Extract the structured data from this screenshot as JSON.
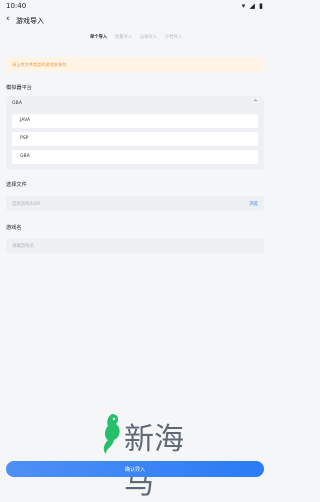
{
  "status": {
    "time": "10:40"
  },
  "appbar": {
    "title": "游戏导入"
  },
  "tabs": [
    {
      "label": "单个导入"
    },
    {
      "label": "批量导入"
    },
    {
      "label": "压缩导入"
    },
    {
      "label": "存档导入"
    }
  ],
  "notice": {
    "text": "请上传文件类型的游戏安装包"
  },
  "platform": {
    "label": "模拟器平台",
    "selected": "GBA",
    "options": [
      {
        "label": "JAVA"
      },
      {
        "label": "PSP"
      },
      {
        "label": "GBA"
      }
    ]
  },
  "file": {
    "label": "选择文件",
    "placeholder": "选择游戏ROM",
    "browse": "浏览"
  },
  "name": {
    "label": "游戏名",
    "placeholder": "请输游戏名"
  },
  "watermark": {
    "text": "新海马"
  },
  "confirm": {
    "label": "确认导入"
  },
  "colors": {
    "accent": "#2a7bf6",
    "warning": "#e39a3b",
    "background": "#f5f6f8"
  }
}
